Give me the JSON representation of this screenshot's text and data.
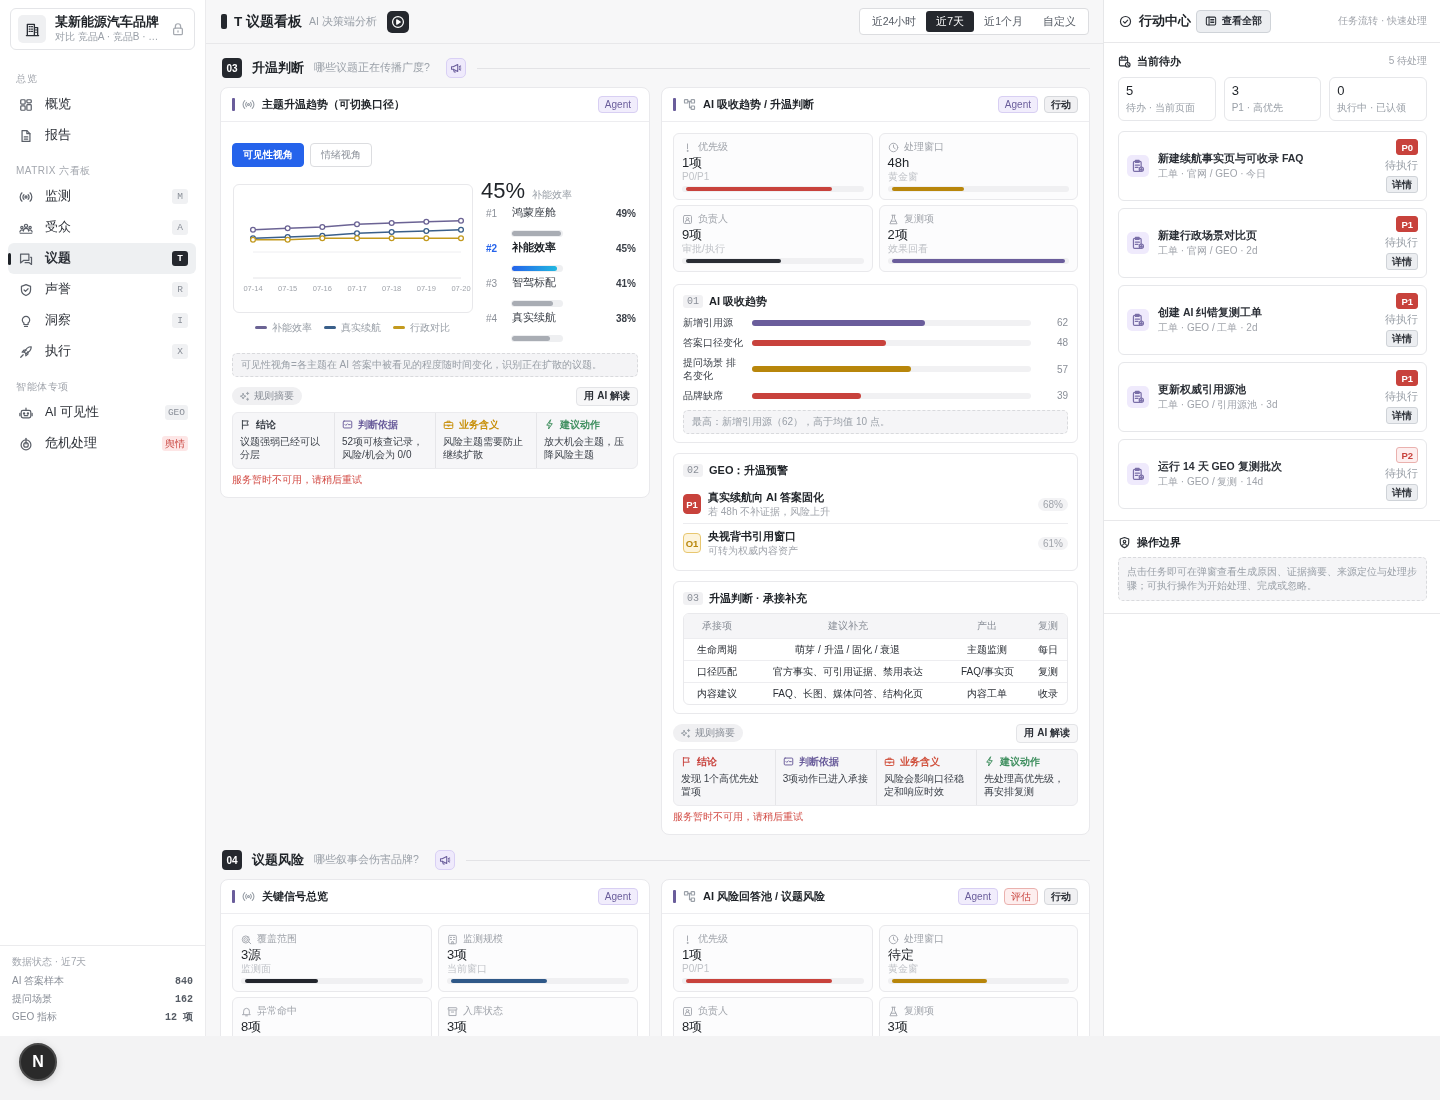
{
  "sidebar": {
    "brand": {
      "name": "某新能源汽车品牌",
      "subtitle": "对比 竞品A · 竞品B · …"
    },
    "groups": [
      {
        "label": "总览",
        "items": [
          {
            "label": "概览",
            "selected": false
          },
          {
            "label": "报告",
            "selected": false
          }
        ]
      },
      {
        "label": "MATRIX 六看板",
        "items": [
          {
            "label": "监测",
            "badge": "M",
            "selected": false
          },
          {
            "label": "受众",
            "badge": "A",
            "selected": false
          },
          {
            "label": "议题",
            "badge": "T",
            "selected": true
          },
          {
            "label": "声誉",
            "badge": "R",
            "selected": false
          },
          {
            "label": "洞察",
            "badge": "I",
            "selected": false
          },
          {
            "label": "执行",
            "badge": "X",
            "selected": false
          }
        ]
      },
      {
        "label": "智能体专项",
        "items": [
          {
            "label": "AI 可见性",
            "badge": "GEO",
            "kind": "plain",
            "selected": false
          },
          {
            "label": "危机处理",
            "badge": "舆情",
            "kind": "alert",
            "selected": false
          }
        ]
      }
    ],
    "data_status": {
      "title": "数据状态 · 近7天",
      "rows": [
        {
          "label": "AI 答案样本",
          "value": "840"
        },
        {
          "label": "提问场景",
          "value": "162"
        },
        {
          "label": "GEO 指标",
          "value": "12 项"
        }
      ]
    }
  },
  "header": {
    "title": "T 议题看板",
    "subtitle": "AI 决策端分析",
    "time_ranges": [
      {
        "label": "近24小时",
        "selected": false
      },
      {
        "label": "近7天",
        "selected": true
      },
      {
        "label": "近1个月",
        "selected": false
      },
      {
        "label": "自定义",
        "selected": false
      }
    ]
  },
  "sections": [
    {
      "number": "03",
      "title": "升温判断",
      "question": "哪些议题正在传播广度?",
      "cards": [
        {
          "kind": "trend",
          "title": "主题升温趋势（可切换口径）",
          "tags": [
            {
              "label": "Agent",
              "kind": "agent"
            }
          ],
          "view_tabs": [
            {
              "label": "可见性视角",
              "selected": true
            },
            {
              "label": "情绪视角",
              "selected": false
            }
          ],
          "trend_chart": {
            "x_labels": [
              "07-14",
              "07-15",
              "07-16",
              "07-17",
              "07-18",
              "07-19",
              "07-20"
            ],
            "legend": [
              {
                "name": "补能效率",
                "color": "#6b6394"
              },
              {
                "name": "真实续航",
                "color": "#3a5f8a"
              },
              {
                "name": "行政对比",
                "color": "#c39a1e"
              }
            ]
          },
          "headline": {
            "value": "45%",
            "label": "补能效率"
          },
          "ranking": [
            {
              "rank": "#1",
              "name": "鸿蒙座舱",
              "value": "49%",
              "level": 0.98,
              "selected": false
            },
            {
              "rank": "#2",
              "name": "补能效率",
              "value": "45%",
              "level": 0.9,
              "selected": true
            },
            {
              "rank": "#3",
              "name": "智驾标配",
              "value": "41%",
              "level": 0.82,
              "selected": false
            },
            {
              "rank": "#4",
              "name": "真实续航",
              "value": "38%",
              "level": 0.76,
              "selected": false
            }
          ],
          "note": "可见性视角=各主题在 AI 答案中被看见的程度随时间变化，识别正在扩散的议题。",
          "summary": {
            "chip": "规则摘要",
            "ai_button": "用 AI 解读",
            "columns": [
              {
                "label": "结论",
                "text": "议题强弱已经可以分层",
                "color": "#3a3f47"
              },
              {
                "label": "判断依据",
                "text": "52项可核查记录，风险/机会为 0/0",
                "color": "#6a5d9b"
              },
              {
                "label": "业务含义",
                "text": "风险主题需要防止继续扩散",
                "color": "#c8900a"
              },
              {
                "label": "建议动作",
                "text": "放大机会主题，压降风险主题",
                "color": "#3f8f5f"
              }
            ]
          },
          "error": "服务暂时不可用，请稍后重试"
        },
        {
          "kind": "absorption",
          "title": "AI 吸收趋势 / 升温判断",
          "tags": [
            {
              "label": "Agent",
              "kind": "agent"
            },
            {
              "label": "行动",
              "kind": "action"
            }
          ],
          "metrics": [
            {
              "label": "优先级",
              "value": "1项",
              "sub": "P0/P1",
              "level": 0.84,
              "color": "#c8423c"
            },
            {
              "label": "处理窗口",
              "value": "48h",
              "sub": "黄金窗",
              "level": 0.42,
              "color": "#b8860b"
            },
            {
              "label": "负责人",
              "value": "9项",
              "sub": "审批/执行",
              "level": 0.55,
              "color": "#2a2d34"
            },
            {
              "label": "复测项",
              "value": "2项",
              "sub": "效果回看",
              "level": 1,
              "color": "#6a5d9b"
            }
          ],
          "panels": [
            {
              "kind": "bars",
              "number": "01",
              "title": "AI 吸收趋势",
              "rows": [
                {
                  "label": "新增引用源",
                  "value": "62",
                  "level": 0.62,
                  "color": "#6a5d9b"
                },
                {
                  "label": "答案口径变化",
                  "value": "48",
                  "level": 0.48,
                  "color": "#c8423c"
                },
                {
                  "label": "提问场景 排名变化",
                  "value": "57",
                  "level": 0.57,
                  "color": "#b8860b"
                },
                {
                  "label": "品牌缺席",
                  "value": "39",
                  "level": 0.39,
                  "color": "#c8423c"
                }
              ],
              "note": "最高：新增引用源（62），高于均值 10 点。"
            },
            {
              "kind": "alerts",
              "number": "02",
              "title": "GEO：升温预警",
              "items": [
                {
                  "badge": "P1",
                  "kind": "risk",
                  "title": "真实续航向 AI 答案固化",
                  "sub": "若 48h 不补证据，风险上升",
                  "value": "68%"
                },
                {
                  "badge": "O1",
                  "kind": "opportunity",
                  "title": "央视背书引用窗口",
                  "sub": "可转为权威内容资产",
                  "value": "61%"
                }
              ]
            },
            {
              "kind": "table",
              "number": "03",
              "title": "升温判断 · 承接补充",
              "columns": [
                "承接项",
                "建议补充",
                "产出",
                "复测"
              ],
              "rows": [
                [
                  "生命周期",
                  "萌芽 / 升温 / 固化 / 衰退",
                  "主题监测",
                  "每日"
                ],
                [
                  "口径匹配",
                  "官方事实、可引用证据、禁用表达",
                  "FAQ/事实页",
                  "复测"
                ],
                [
                  "内容建议",
                  "FAQ、长图、媒体问答、结构化页",
                  "内容工单",
                  "收录"
                ]
              ]
            }
          ],
          "summary": {
            "chip": "规则摘要",
            "ai_button": "用 AI 解读",
            "columns": [
              {
                "label": "结论",
                "text": "发现 1个高优先处置项",
                "color": "#c8423c"
              },
              {
                "label": "判断依据",
                "text": "3项动作已进入承接",
                "color": "#6a5d9b"
              },
              {
                "label": "业务含义",
                "text": "风险会影响口径稳定和响应时效",
                "color": "#d0503c"
              },
              {
                "label": "建议动作",
                "text": "先处理高优先级，再安排复测",
                "color": "#3f8f5f"
              }
            ]
          },
          "error": "服务暂时不可用，请稍后重试"
        }
      ]
    },
    {
      "number": "04",
      "title": "议题风险",
      "question": "哪些叙事会伤害品牌?",
      "cards": [
        {
          "kind": "signals",
          "title": "关键信号总览",
          "tags": [
            {
              "label": "Agent",
              "kind": "agent"
            }
          ],
          "metrics": [
            {
              "label": "覆盖范围",
              "value": "3源",
              "sub": "监测面",
              "level": 0.42,
              "color": "#23262d"
            },
            {
              "label": "监测规模",
              "value": "3项",
              "sub": "当前窗口",
              "level": 0.55,
              "color": "#2f5888"
            },
            {
              "label": "异常命中",
              "value": "8项"
            },
            {
              "label": "入库状态",
              "value": "3项"
            }
          ]
        },
        {
          "kind": "risk_pool",
          "title": "AI 风险回答池 / 议题风险",
          "tags": [
            {
              "label": "Agent",
              "kind": "agent"
            },
            {
              "label": "评估",
              "kind": "eval"
            },
            {
              "label": "行动",
              "kind": "action"
            }
          ],
          "metrics": [
            {
              "label": "优先级",
              "value": "1项",
              "sub": "P0/P1",
              "level": 0.84,
              "color": "#c8423c"
            },
            {
              "label": "处理窗口",
              "value": "待定",
              "sub": "黄金窗",
              "level": 0.55,
              "color": "#b8860b"
            },
            {
              "label": "负责人",
              "value": "8项"
            },
            {
              "label": "复测项",
              "value": "3项"
            }
          ]
        }
      ]
    }
  ],
  "action_center": {
    "title": "行动中心",
    "view_all": "查看全部",
    "caption": "任务流转 · 快速处理",
    "todo": {
      "title": "当前待办",
      "count": "5 待处理",
      "stats": [
        {
          "value": "5",
          "label": "待办 · 当前页面"
        },
        {
          "value": "3",
          "label": "P1 · 高优先"
        },
        {
          "value": "0",
          "label": "执行中 · 已认领"
        }
      ],
      "tasks": [
        {
          "title": "新建续航事实页与可收录 FAQ",
          "meta": "工单 · 官网 / GEO · 今日",
          "priority": "P0",
          "kind": "high",
          "status": "待执行",
          "action": "详情"
        },
        {
          "title": "新建行政场景对比页",
          "meta": "工单 · 官网 / GEO · 2d",
          "priority": "P1",
          "kind": "high",
          "status": "待执行",
          "action": "详情"
        },
        {
          "title": "创建 AI 纠错复测工单",
          "meta": "工单 · GEO / 工单 · 2d",
          "priority": "P1",
          "kind": "high",
          "status": "待执行",
          "action": "详情"
        },
        {
          "title": "更新权威引用源池",
          "meta": "工单 · GEO / 引用源池 · 3d",
          "priority": "P1",
          "kind": "high",
          "status": "待执行",
          "action": "详情"
        },
        {
          "title": "运行 14 天 GEO 复测批次",
          "meta": "工单 · GEO / 复测 · 14d",
          "priority": "P2",
          "kind": "low",
          "status": "待执行",
          "action": "详情"
        }
      ]
    },
    "boundary": {
      "title": "操作边界",
      "note": "点击任务即可在弹窗查看生成原因、证据摘要、来源定位与处理步骤；可执行操作为开始处理、完成或忽略。"
    }
  },
  "dev_badge": "N"
}
